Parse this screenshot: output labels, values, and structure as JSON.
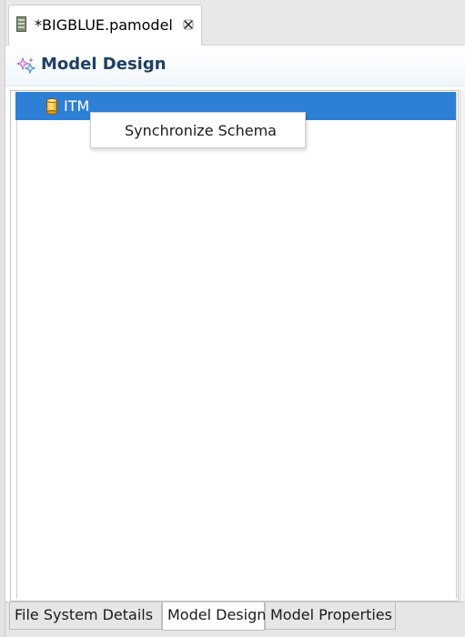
{
  "editor_tab": {
    "title": "*BIGBLUE.pamodel",
    "file_icon": "pamodel-file-icon",
    "close_icon": "close-icon"
  },
  "form": {
    "title": "Model Design",
    "icon": "model-design-icon"
  },
  "tree": {
    "items": [
      {
        "label": "ITM",
        "icon": "database-icon",
        "selected": true
      }
    ]
  },
  "context_menu": {
    "items": [
      {
        "label": "Synchronize Schema"
      }
    ]
  },
  "page_tabs": [
    {
      "label": "File System Details",
      "active": false
    },
    {
      "label": "Model Design",
      "active": true
    },
    {
      "label": "Model Properties",
      "active": false
    }
  ],
  "colors": {
    "selection": "#2e7fd6",
    "header_title": "#1f3f66"
  }
}
